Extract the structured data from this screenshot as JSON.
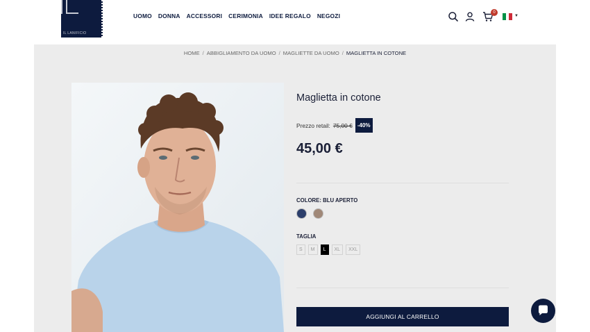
{
  "logo": {
    "text": "IL LANIFICIO"
  },
  "nav": {
    "items": [
      "UOMO",
      "DONNA",
      "ACCESSORI",
      "CERIMONIA",
      "IDEE REGALO",
      "NEGOZI"
    ]
  },
  "header": {
    "cart_count": "0",
    "icons": [
      "search-icon",
      "user-icon",
      "cart-icon",
      "italy-flag-icon",
      "chevron-down-icon"
    ]
  },
  "breadcrumb": {
    "items": [
      "HOME",
      "ABBIGLIAMENTO DA UOMO",
      "MAGLIETTE DA UOMO"
    ],
    "current": "MAGLIETTA IN COTONE",
    "separator": "/"
  },
  "product": {
    "title": "Maglietta in cotone",
    "retail_label": "Prezzo retail:",
    "retail_price": "75,00 €",
    "discount": "-40%",
    "price": "45,00 €",
    "color_label": "COLORE: BLU APERTO",
    "colors": [
      "#2c3e6b",
      "#a08878"
    ],
    "size_label": "TAGLIA",
    "sizes": [
      "S",
      "M",
      "L",
      "XL",
      "XXL"
    ],
    "selected_size": "L",
    "add_to_cart": "AGGIUNGI AL CARRELLO"
  },
  "colors": {
    "brand": "#0d1b3e",
    "panel": "#ececec",
    "badge": "#c0392b"
  }
}
